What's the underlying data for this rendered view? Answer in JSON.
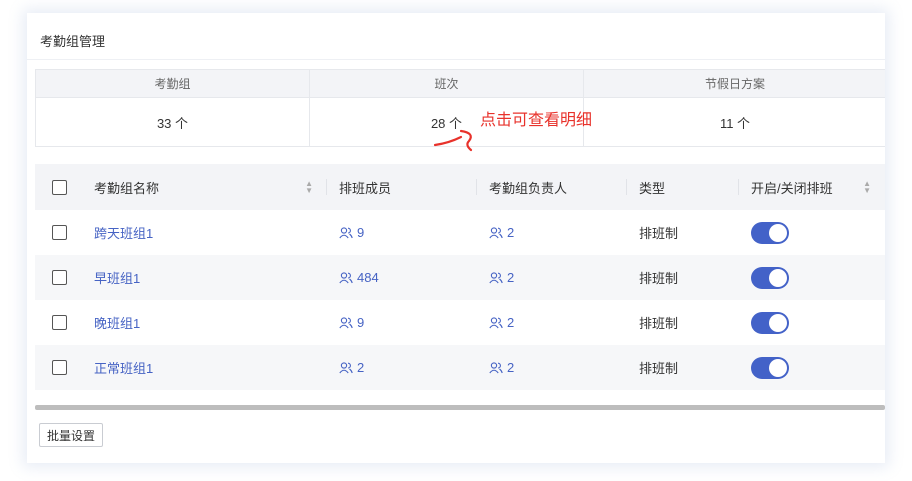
{
  "panel": {
    "title": "考勤组管理"
  },
  "stats": {
    "headers": [
      "考勤组",
      "班次",
      "节假日方案"
    ],
    "values": [
      "33 个",
      "28 个",
      "11 个"
    ]
  },
  "annotation": {
    "text": "点击可查看明细",
    "color": "#e8322b"
  },
  "table": {
    "columns": [
      "考勤组名称",
      "排班成员",
      "考勤组负责人",
      "类型",
      "开启/关闭排班"
    ],
    "rows": [
      {
        "name": "跨天班组1",
        "members": "9",
        "owners": "2",
        "type": "排班制",
        "enabled": true
      },
      {
        "name": "早班组1",
        "members": "484",
        "owners": "2",
        "type": "排班制",
        "enabled": true
      },
      {
        "name": "晚班组1",
        "members": "9",
        "owners": "2",
        "type": "排班制",
        "enabled": true
      },
      {
        "name": "正常班组1",
        "members": "2",
        "owners": "2",
        "type": "排班制",
        "enabled": true
      }
    ]
  },
  "footer": {
    "batch_button": "批量设置"
  },
  "colors": {
    "link": "#4663c4",
    "switch_on": "#4362c8",
    "header_bg": "#f3f4f7"
  },
  "icons": {
    "members": "people-icon",
    "sort": "sort-icon"
  }
}
